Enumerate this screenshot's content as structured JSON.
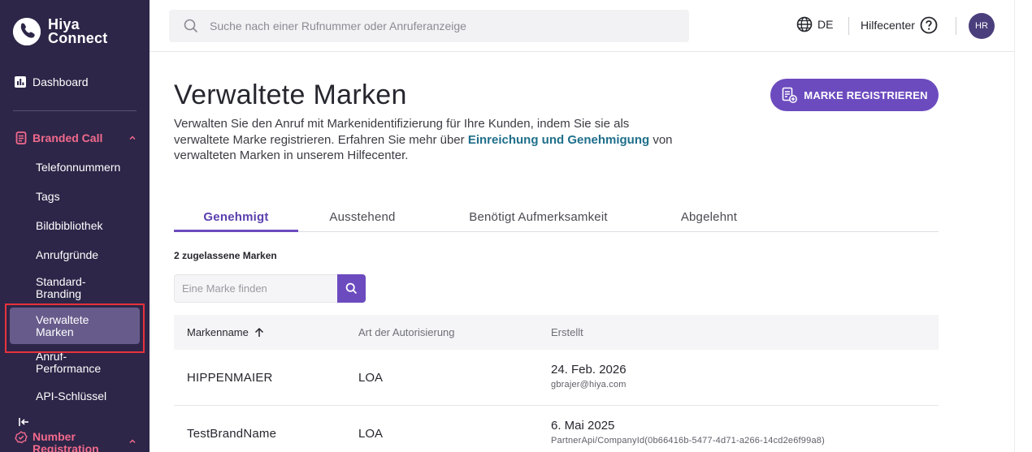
{
  "app": {
    "logo_line1": "Hiya",
    "logo_line2": "Connect"
  },
  "sidebar": {
    "dashboard_label": "Dashboard",
    "branded_call": {
      "label": "Branded Call",
      "items": [
        {
          "label": "Telefonnummern"
        },
        {
          "label": "Tags"
        },
        {
          "label": "Bildbibliothek"
        },
        {
          "label": "Anrufgründe"
        },
        {
          "label": "Standard-Branding"
        },
        {
          "label": "Verwaltete Marken",
          "active": true
        },
        {
          "label": "Anruf-Performance"
        },
        {
          "label": "API-Schlüssel"
        }
      ]
    },
    "number_registration_label": "Number Registration"
  },
  "topbar": {
    "search_placeholder": "Suche nach einer Rufnummer oder Anruferanzeige",
    "language": "DE",
    "help_label": "Hilfecenter",
    "avatar_initials": "HR"
  },
  "main": {
    "title": "Verwaltete Marken",
    "register_button": "MARKE REGISTRIEREN",
    "intro_text_1": "Verwalten Sie den Anruf mit Markenidentifizierung für Ihre Kunden, indem Sie sie als verwaltete Marke registrieren. Erfahren Sie mehr über ",
    "intro_link": "Einreichung und Genehmigung",
    "intro_text_2": " von verwalteten Marken in unserem Hilfecenter.",
    "tabs": [
      {
        "label": "Genehmigt",
        "active": true
      },
      {
        "label": "Ausstehend"
      },
      {
        "label": "Benötigt Aufmerksamkeit"
      },
      {
        "label": "Abgelehnt"
      }
    ],
    "count_label": "2 zugelassene Marken",
    "brand_search_placeholder": "Eine Marke finden"
  },
  "chart_data": {
    "type": "table",
    "columns": [
      "Markenname",
      "Art der Autorisierung",
      "Erstellt"
    ],
    "sorted_column": "Markenname",
    "sort_direction": "ascending",
    "rows": [
      {
        "name": "HIPPENMAIER",
        "auth": "LOA",
        "created": "24. Feb. 2026",
        "created_by": "gbrajer@hiya.com"
      },
      {
        "name": "TestBrandName",
        "auth": "LOA",
        "created": "6. Mai 2025",
        "created_by": "PartnerApi/CompanyId(0b66416b-5477-4d71-a266-14cd2e6f99a8)"
      }
    ]
  },
  "colors": {
    "sidebar_bg": "#2d2648",
    "sidebar_active_bg": "#675b8b",
    "section_accent": "#f26a8d",
    "primary": "#6c4bbf",
    "link": "#1f6f8b",
    "highlight_box": "#e8323c"
  },
  "icons": {
    "logo": "hiya-logo-icon",
    "dashboard": "bar-chart-icon",
    "branded_call": "phone-list-icon",
    "number_registration": "badge-check-icon",
    "search": "search-icon",
    "language": "globe-icon",
    "help": "question-circle-icon",
    "register": "document-add-icon",
    "sort": "arrow-up-icon",
    "collapse": "collapse-sidebar-icon"
  }
}
